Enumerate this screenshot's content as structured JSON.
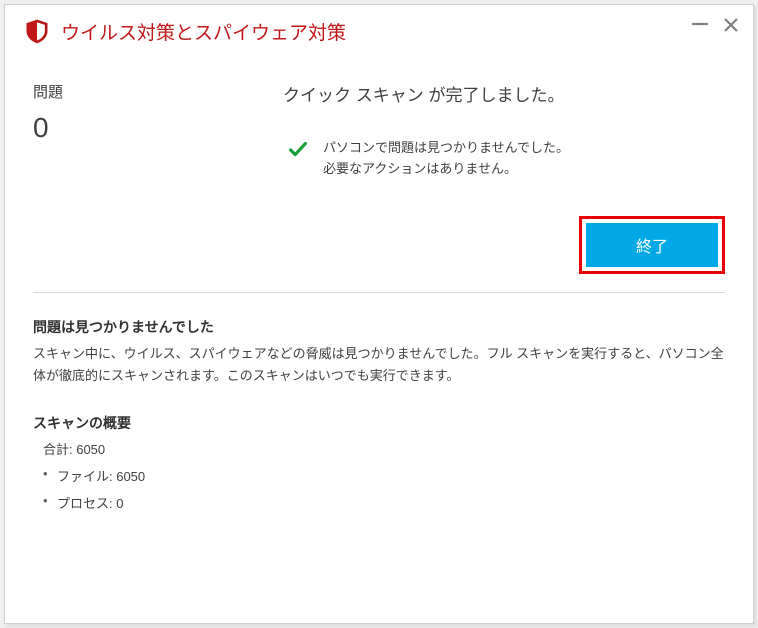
{
  "titlebar": {
    "title": "ウイルス対策とスパイウェア対策"
  },
  "scan": {
    "problems_label": "問題",
    "problems_count": "0",
    "complete_title": "クイック スキャン が完了しました。",
    "result_line1": "パソコンで問題は見つかりませんでした。",
    "result_line2": "必要なアクションはありません。",
    "finish_button": "終了"
  },
  "details": {
    "not_found_heading": "問題は見つかりませんでした",
    "not_found_text": "スキャン中に、ウイルス、スパイウェアなどの脅威は見つかりませんでした。フル スキャンを実行すると、パソコン全体が徹底的にスキャンされます。このスキャンはいつでも実行できます。"
  },
  "summary": {
    "heading": "スキャンの概要",
    "total": "合計: 6050",
    "files": "ファイル: 6050",
    "processes": "プロセス: 0"
  }
}
